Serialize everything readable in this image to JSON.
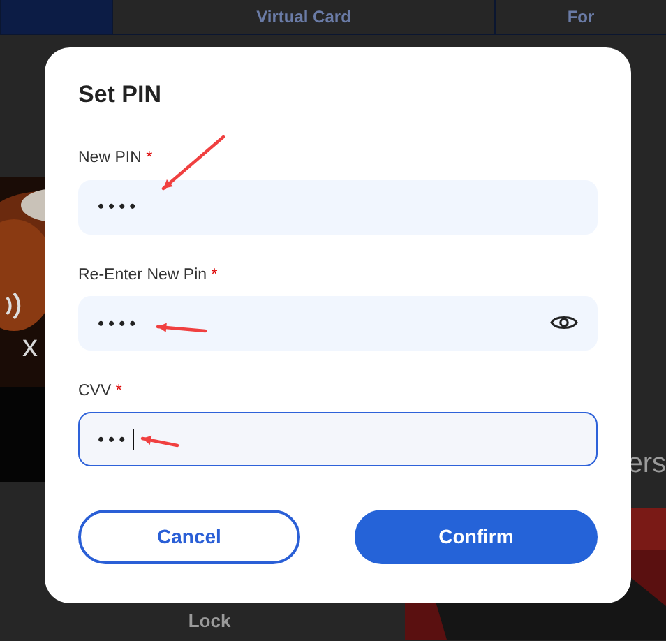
{
  "background": {
    "tabs": [
      {
        "selected": true
      },
      {
        "label": "Virtual Card",
        "selected": false
      },
      {
        "label": "For",
        "selected": false
      }
    ],
    "card_number": "x",
    "side_heading": "ers",
    "lock_label": "Lock"
  },
  "dialog": {
    "title": "Set PIN",
    "fields": [
      {
        "label": "New PIN",
        "required_mark": "*",
        "value": "••••",
        "reveal_toggle": false,
        "focused": false,
        "pointer_arrow": true
      },
      {
        "label": "Re-Enter New Pin",
        "required_mark": "*",
        "value": "••••",
        "reveal_toggle": true,
        "focused": false,
        "pointer_arrow": true
      },
      {
        "label": "CVV",
        "required_mark": "*",
        "value": "•••",
        "reveal_toggle": false,
        "focused": true,
        "pointer_arrow": true
      }
    ],
    "buttons": [
      {
        "label": "Cancel",
        "kind": "outline"
      },
      {
        "label": "Confirm",
        "kind": "primary"
      }
    ]
  }
}
